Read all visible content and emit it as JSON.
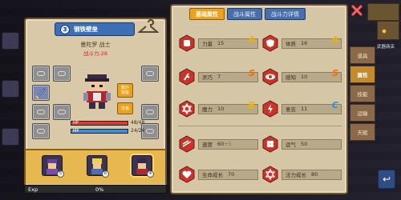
{
  "character": {
    "title": "钢铁壁垒",
    "title_badge": "3",
    "name_line": "曼陀罗  战士",
    "power_line": "战斗力:28",
    "side_buttons": {
      "extra_skill": "额外\n技能",
      "personality": "性格"
    },
    "hp": {
      "label": "HP",
      "current": 48,
      "max": 48,
      "text": "48/48"
    },
    "mp": {
      "label": "MP",
      "current": 24,
      "max": 24,
      "text": "24/24"
    },
    "exp": {
      "label": "Exp",
      "value": "0%"
    },
    "pets": [
      {
        "level": "5"
      },
      {
        "level": "6"
      },
      {
        "level": "4"
      }
    ]
  },
  "tabs": [
    {
      "label": "基础属性",
      "active": true
    },
    {
      "label": "战斗属性",
      "active": false
    },
    {
      "label": "战斗力详情",
      "active": false
    }
  ],
  "stats": [
    {
      "name": "力量",
      "value": "15",
      "grade": "A",
      "grade_color": "#f0b400",
      "icon": "fist-icon"
    },
    {
      "name": "体质",
      "value": "16",
      "grade": "A",
      "grade_color": "#f0b400",
      "icon": "shield-body-icon"
    },
    {
      "name": "灵巧",
      "value": "7",
      "grade": "S",
      "grade_color": "#ff6a00",
      "icon": "running-icon"
    },
    {
      "name": "感知",
      "value": "10",
      "grade": "S",
      "grade_color": "#ff6a00",
      "icon": "eye-icon"
    },
    {
      "name": "魔力",
      "value": "10",
      "grade": "B",
      "grade_color": "#f0b400",
      "icon": "star-of-david-icon"
    },
    {
      "name": "意志",
      "value": "11",
      "grade": "C",
      "grade_color": "#2f8be0",
      "icon": "bolt-shield-icon"
    },
    {
      "name": "速度",
      "value": "60",
      "bonus": "+5",
      "icon": "speed-icon"
    },
    {
      "name": "运气",
      "value": "50",
      "icon": "clover-icon"
    },
    {
      "name": "生命成长",
      "value": "70",
      "icon": "heart-growth-icon"
    },
    {
      "name": "法力成长",
      "value": "80",
      "icon": "star-growth-icon"
    }
  ],
  "side_menu": [
    {
      "label": "道具",
      "active": false
    },
    {
      "label": "属性",
      "active": true
    },
    {
      "label": "技能",
      "active": false
    },
    {
      "label": "运输",
      "active": false
    },
    {
      "label": "天赋",
      "active": false
    }
  ],
  "hud": {
    "corner_label": "武器商店"
  },
  "colors": {
    "hp_fill": "#d83a3a",
    "mp_fill": "#3a8fd8",
    "tab_active": "#f0a21b",
    "tab_inactive": "#4a6fa8"
  }
}
